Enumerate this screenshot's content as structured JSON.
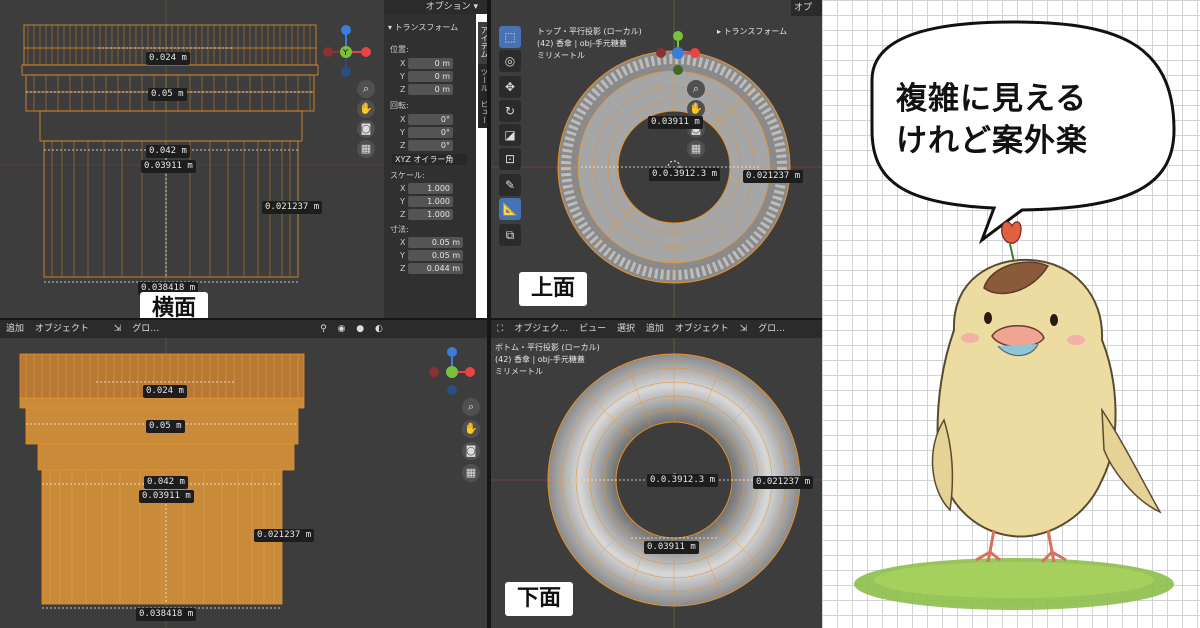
{
  "labels": {
    "side": "横面",
    "top": "上面",
    "bottom": "下面"
  },
  "measurements": {
    "top_teeth": "0.024 m",
    "collar": "0.05 m",
    "body_outer": "0.042 m",
    "body_inner": "0.03911 m",
    "height": "0.021237 m",
    "base": "0.038418 m",
    "side_b_collar": "0.05 m",
    "overlap": "0.0.3912.3 m"
  },
  "top_right_header": {
    "options": "オプション ▾",
    "options_right": "オプ"
  },
  "npanel": {
    "section": "トランスフォーム",
    "location_label": "位置:",
    "rotation_label": "回転:",
    "scale_label": "スケール:",
    "dimensions_label": "寸法:",
    "mode": "XYZ オイラー角",
    "axes": [
      "X",
      "Y",
      "Z"
    ],
    "location": [
      "0 m",
      "0 m",
      "0 m"
    ],
    "rotation": [
      "0°",
      "0°",
      "0°"
    ],
    "scale": [
      "1.000",
      "1.000",
      "1.000"
    ],
    "dimensions": [
      "0.05 m",
      "0.05 m",
      "0.044 m"
    ],
    "tabs": [
      "アイテム",
      "ツール",
      "ビュー"
    ]
  },
  "top_view_info": {
    "title": "トップ・平行投影 (ローカル)",
    "object": "(42) 香傘 | obj-手元糖蓋",
    "units": "ミリメートル",
    "transform_btn": "トランスフォーム"
  },
  "bottom_view_info": {
    "title": "ボトム・平行投影 (ローカル)",
    "object": "(42) 香傘 | obj-手元糖蓋",
    "units": "ミリメートル"
  },
  "mid_header_left": {
    "add": "追加",
    "object": "オブジェクト",
    "global": "グロ…"
  },
  "mid_header_right": {
    "object_mode": "オブジェク…",
    "view": "ビュー",
    "select": "選択",
    "add": "追加",
    "object": "オブジェクト",
    "global": "グロ…"
  },
  "bubble": {
    "line1": "複雑に見える",
    "line2": "けれど案外楽"
  },
  "colors": {
    "viewport": "#3d3d3d",
    "wire": "#e8902a",
    "header": "#2b2b2b",
    "accent": "#4772b3"
  }
}
